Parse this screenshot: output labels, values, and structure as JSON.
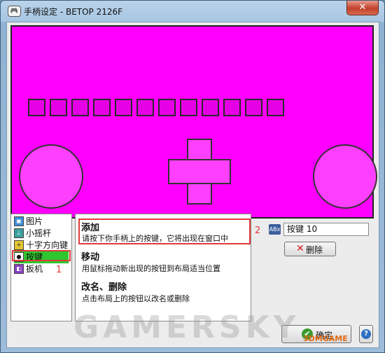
{
  "window": {
    "title": "手柄设定 - BETOP 2126F",
    "close_glyph": "✕"
  },
  "layout_items": [
    {
      "label": "图片",
      "icon": "picture-icon",
      "icon_glyph": "▣"
    },
    {
      "label": "小摇杆",
      "icon": "joystick-icon",
      "icon_glyph": "⊥"
    },
    {
      "label": "十字方向键",
      "icon": "dpad-icon",
      "icon_glyph": "+"
    },
    {
      "label": "按键",
      "icon": "button-icon",
      "icon_glyph": "●"
    },
    {
      "label": "扳机",
      "icon": "trigger-icon",
      "icon_glyph": "◧"
    }
  ],
  "selected_item": "按键",
  "help": {
    "add_title": "添加",
    "add_desc": "请按下你手柄上的按键，它将出现在窗口中",
    "move_title": "移动",
    "move_desc": "用鼠标拖动新出现的按钮到布局适当位置",
    "rename_title": "改名、删除",
    "rename_desc": "点击布局上的按钮以改名或删除"
  },
  "properties": {
    "device_icon": "ABx",
    "name_value": "按键 10",
    "delete_label": "删除",
    "delete_glyph": "✕"
  },
  "footer": {
    "ok_label": "确定",
    "ok_glyph": "✔",
    "help_glyph": "?"
  },
  "annotations": {
    "marker_1": "1",
    "marker_2": "2"
  },
  "watermark": {
    "text": "GAMERSKY",
    "corner_text": "3DMGAME"
  },
  "colors": {
    "canvas": "#ff00ff",
    "selection": "#2fc62f",
    "annotation": "#e23a3a"
  }
}
